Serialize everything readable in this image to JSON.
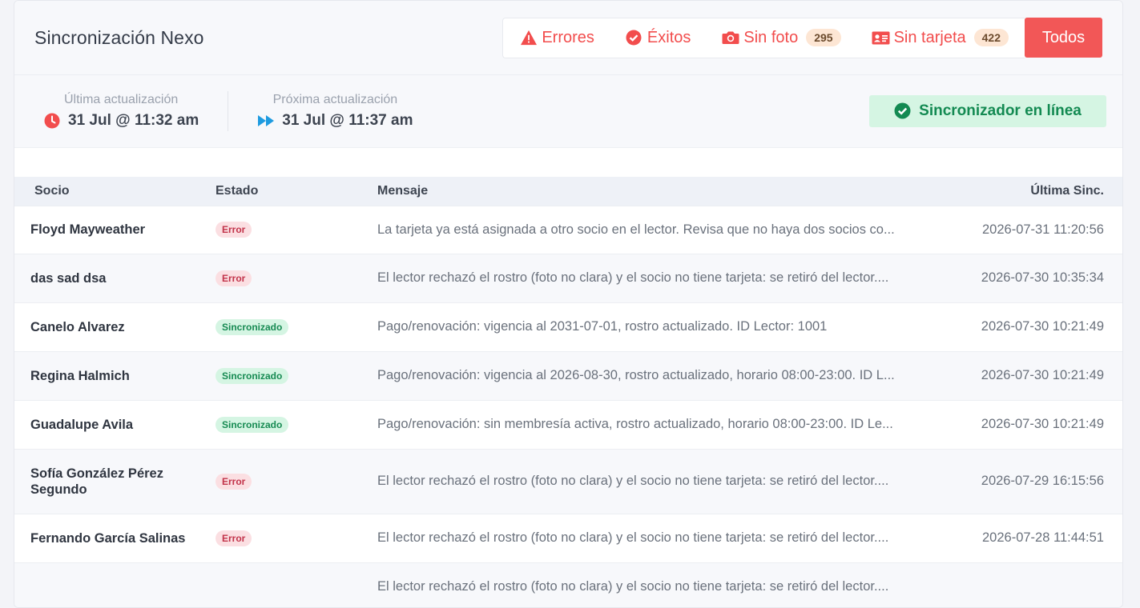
{
  "header": {
    "title": "Sincronización Nexo",
    "filters": [
      {
        "label": "Errores",
        "icon": "warning-triangle-icon"
      },
      {
        "label": "Éxitos",
        "icon": "check-circle-icon"
      },
      {
        "label": "Sin foto",
        "icon": "camera-icon",
        "count": "295"
      },
      {
        "label": "Sin tarjeta",
        "icon": "id-card-icon",
        "count": "422"
      }
    ],
    "todos_label": "Todos"
  },
  "info": {
    "last_label": "Última actualización",
    "last_value": "31 Jul @ 11:32 am",
    "next_label": "Próxima actualización",
    "next_value": "31 Jul @ 11:37 am",
    "status_label": "Sincronizador en línea"
  },
  "table": {
    "headers": [
      "Socio",
      "Estado",
      "Mensaje",
      "Última Sinc."
    ],
    "rows": [
      {
        "socio": "Floyd Mayweather",
        "estado": "Error",
        "status": "error",
        "mensaje": "La tarjeta ya está asignada a otro socio en el lector. Revisa que no haya dos socios co...",
        "fecha": "2026-07-31 11:20:56"
      },
      {
        "socio": "das sad dsa",
        "estado": "Error",
        "status": "error",
        "mensaje": "El lector rechazó el rostro (foto no clara) y el socio no tiene tarjeta: se retiró del lector....",
        "fecha": "2026-07-30 10:35:34"
      },
      {
        "socio": "Canelo Alvarez",
        "estado": "Sincronizado",
        "status": "ok",
        "mensaje": "Pago/renovación: vigencia al 2031-07-01, rostro actualizado. ID Lector: 1001",
        "fecha": "2026-07-30 10:21:49"
      },
      {
        "socio": "Regina Halmich",
        "estado": "Sincronizado",
        "status": "ok",
        "mensaje": "Pago/renovación: vigencia al 2026-08-30, rostro actualizado, horario 08:00-23:00. ID L...",
        "fecha": "2026-07-30 10:21:49"
      },
      {
        "socio": "Guadalupe Avila",
        "estado": "Sincronizado",
        "status": "ok",
        "mensaje": "Pago/renovación: sin membresía activa, rostro actualizado, horario 08:00-23:00. ID Le...",
        "fecha": "2026-07-30 10:21:49"
      },
      {
        "socio": "Sofía González Pérez Segundo",
        "estado": "Error",
        "status": "error",
        "mensaje": "El lector rechazó el rostro (foto no clara) y el socio no tiene tarjeta: se retiró del lector....",
        "fecha": "2026-07-29 16:15:56"
      },
      {
        "socio": "Fernando García Salinas",
        "estado": "Error",
        "status": "error",
        "mensaje": "El lector rechazó el rostro (foto no clara) y el socio no tiene tarjeta: se retiró del lector....",
        "fecha": "2026-07-28 11:44:51"
      },
      {
        "socio": "",
        "estado": "",
        "status": "error",
        "mensaje": "El lector rechazó el rostro (foto no clara) y el socio no tiene tarjeta: se retiró del lector....",
        "fecha": ""
      }
    ]
  },
  "colors": {
    "accent": "#f25757",
    "success": "#138a52",
    "success_bg": "#d5f5e3",
    "error_text": "#c2334a",
    "error_bg": "#fbdfe2"
  }
}
